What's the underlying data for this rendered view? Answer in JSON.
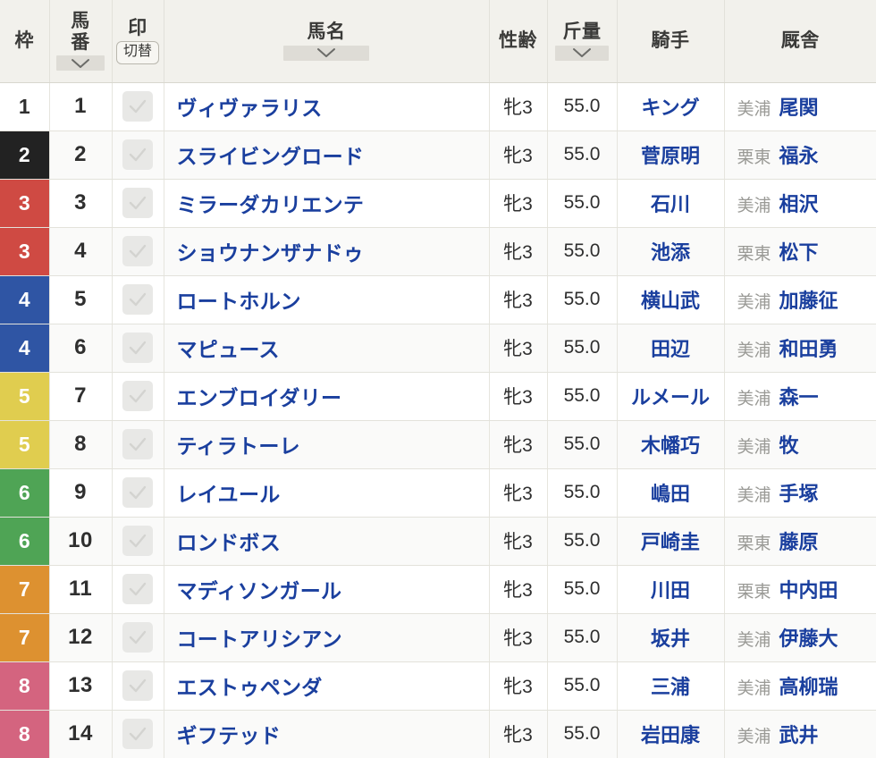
{
  "table": {
    "columns": [
      {
        "key": "waku",
        "label": "枠",
        "sortable": false,
        "stacked": false
      },
      {
        "key": "umaban",
        "label": "馬番",
        "sortable": true,
        "stacked": true
      },
      {
        "key": "shirushi",
        "label": "印",
        "sortable": false,
        "stacked": false,
        "toggle_label": "切替"
      },
      {
        "key": "bamei",
        "label": "馬名",
        "sortable": true,
        "stacked": false
      },
      {
        "key": "seirei",
        "label": "性齢",
        "sortable": false,
        "stacked": false
      },
      {
        "key": "kinryo",
        "label": "斤量",
        "sortable": true,
        "stacked": false
      },
      {
        "key": "kishu",
        "label": "騎手",
        "sortable": false,
        "stacked": false
      },
      {
        "key": "kyusha",
        "label": "厩舎",
        "sortable": false,
        "stacked": false
      }
    ],
    "rows": [
      {
        "waku": "1",
        "umaban": "1",
        "bamei": "ヴィヴァラリス",
        "seirei": "牝3",
        "kinryo": "55.0",
        "kishu": "キング",
        "belong": "美浦",
        "trainer": "尾関"
      },
      {
        "waku": "2",
        "umaban": "2",
        "bamei": "スライビングロード",
        "seirei": "牝3",
        "kinryo": "55.0",
        "kishu": "菅原明",
        "belong": "栗東",
        "trainer": "福永"
      },
      {
        "waku": "3",
        "umaban": "3",
        "bamei": "ミラーダカリエンテ",
        "seirei": "牝3",
        "kinryo": "55.0",
        "kishu": "石川",
        "belong": "美浦",
        "trainer": "相沢"
      },
      {
        "waku": "3",
        "umaban": "4",
        "bamei": "ショウナンザナドゥ",
        "seirei": "牝3",
        "kinryo": "55.0",
        "kishu": "池添",
        "belong": "栗東",
        "trainer": "松下"
      },
      {
        "waku": "4",
        "umaban": "5",
        "bamei": "ロートホルン",
        "seirei": "牝3",
        "kinryo": "55.0",
        "kishu": "横山武",
        "belong": "美浦",
        "trainer": "加藤征"
      },
      {
        "waku": "4",
        "umaban": "6",
        "bamei": "マピュース",
        "seirei": "牝3",
        "kinryo": "55.0",
        "kishu": "田辺",
        "belong": "美浦",
        "trainer": "和田勇"
      },
      {
        "waku": "5",
        "umaban": "7",
        "bamei": "エンブロイダリー",
        "seirei": "牝3",
        "kinryo": "55.0",
        "kishu": "ルメール",
        "belong": "美浦",
        "trainer": "森一"
      },
      {
        "waku": "5",
        "umaban": "8",
        "bamei": "ティラトーレ",
        "seirei": "牝3",
        "kinryo": "55.0",
        "kishu": "木幡巧",
        "belong": "美浦",
        "trainer": "牧"
      },
      {
        "waku": "6",
        "umaban": "9",
        "bamei": "レイユール",
        "seirei": "牝3",
        "kinryo": "55.0",
        "kishu": "嶋田",
        "belong": "美浦",
        "trainer": "手塚"
      },
      {
        "waku": "6",
        "umaban": "10",
        "bamei": "ロンドボス",
        "seirei": "牝3",
        "kinryo": "55.0",
        "kishu": "戸崎圭",
        "belong": "栗東",
        "trainer": "藤原"
      },
      {
        "waku": "7",
        "umaban": "11",
        "bamei": "マディソンガール",
        "seirei": "牝3",
        "kinryo": "55.0",
        "kishu": "川田",
        "belong": "栗東",
        "trainer": "中内田"
      },
      {
        "waku": "7",
        "umaban": "12",
        "bamei": "コートアリシアン",
        "seirei": "牝3",
        "kinryo": "55.0",
        "kishu": "坂井",
        "belong": "美浦",
        "trainer": "伊藤大"
      },
      {
        "waku": "8",
        "umaban": "13",
        "bamei": "エストゥペンダ",
        "seirei": "牝3",
        "kinryo": "55.0",
        "kishu": "三浦",
        "belong": "美浦",
        "trainer": "高柳瑞"
      },
      {
        "waku": "8",
        "umaban": "14",
        "bamei": "ギフテッド",
        "seirei": "牝3",
        "kinryo": "55.0",
        "kishu": "岩田康",
        "belong": "美浦",
        "trainer": "武井"
      }
    ]
  },
  "waku_colors": {
    "1": {
      "bg": "#ffffff",
      "fg": "#2f2f2f"
    },
    "2": {
      "bg": "#222222",
      "fg": "#ffffff"
    },
    "3": {
      "bg": "#cf4a43",
      "fg": "#ffffff"
    },
    "4": {
      "bg": "#2f55a4",
      "fg": "#ffffff"
    },
    "5": {
      "bg": "#e0cd4f",
      "fg": "#ffffff"
    },
    "6": {
      "bg": "#4fa455",
      "fg": "#ffffff"
    },
    "7": {
      "bg": "#dd9130",
      "fg": "#ffffff"
    },
    "8": {
      "bg": "#d4647f",
      "fg": "#ffffff"
    }
  },
  "icons": {
    "sort": "chevron-down-icon",
    "check": "check-icon"
  },
  "theme": {
    "header_bg": "#f2f1ec",
    "link_color": "#1a3f9e",
    "row_alt_bg": "#fafaf9",
    "border_color": "#e3e2db",
    "muted_text": "#9a9a96"
  }
}
